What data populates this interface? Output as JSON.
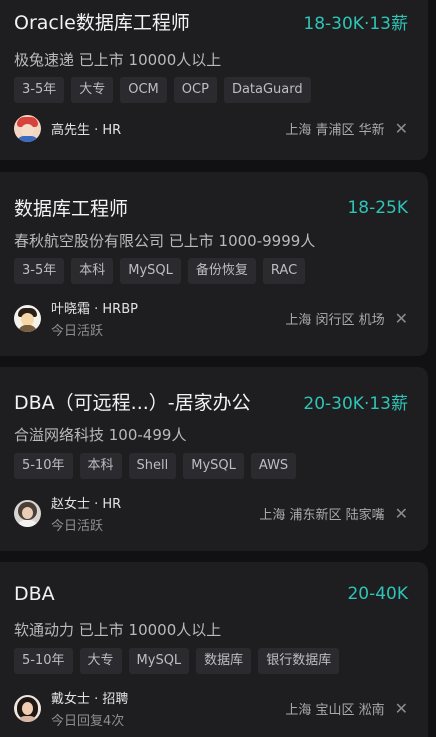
{
  "jobs": [
    {
      "title": "Oracle数据库工程师",
      "salary": "18-30K·13薪",
      "company": "极兔速递 已上市 10000人以上",
      "tags": [
        "3-5年",
        "大专",
        "OCM",
        "OCP",
        "DataGuard"
      ],
      "recruiter": {
        "name": "高先生 · HR",
        "status": ""
      },
      "location": "上海 青浦区 华新",
      "close": "✕"
    },
    {
      "title": "数据库工程师",
      "salary": "18-25K",
      "company": "春秋航空股份有限公司 已上市 1000-9999人",
      "tags": [
        "3-5年",
        "本科",
        "MySQL",
        "备份恢复",
        "RAC"
      ],
      "recruiter": {
        "name": "叶晓霜 · HRBP",
        "status": "今日活跃"
      },
      "location": "上海 闵行区 机场",
      "close": "✕"
    },
    {
      "title": "DBA（可远程...）-居家办公",
      "salary": "20-30K·13薪",
      "company": "合溢网络科技 100-499人",
      "tags": [
        "5-10年",
        "本科",
        "Shell",
        "MySQL",
        "AWS"
      ],
      "recruiter": {
        "name": "赵女士 · HR",
        "status": "今日活跃"
      },
      "location": "上海 浦东新区 陆家嘴",
      "close": "✕"
    },
    {
      "title": "DBA",
      "salary": "20-40K",
      "company": "软通动力 已上市 10000人以上",
      "tags": [
        "5-10年",
        "大专",
        "MySQL",
        "数据库",
        "银行数据库"
      ],
      "recruiter": {
        "name": "戴女士 · 招聘",
        "status": "今日回复4次"
      },
      "location": "上海 宝山区 淞南",
      "close": "✕"
    }
  ],
  "colors": {
    "salary": "#2ec4b6",
    "card_bg": "#1e1e21",
    "page_bg": "#111113",
    "tag_bg": "#2b2b2f"
  },
  "icons": {
    "close": "close-icon",
    "avatar": "avatar"
  }
}
